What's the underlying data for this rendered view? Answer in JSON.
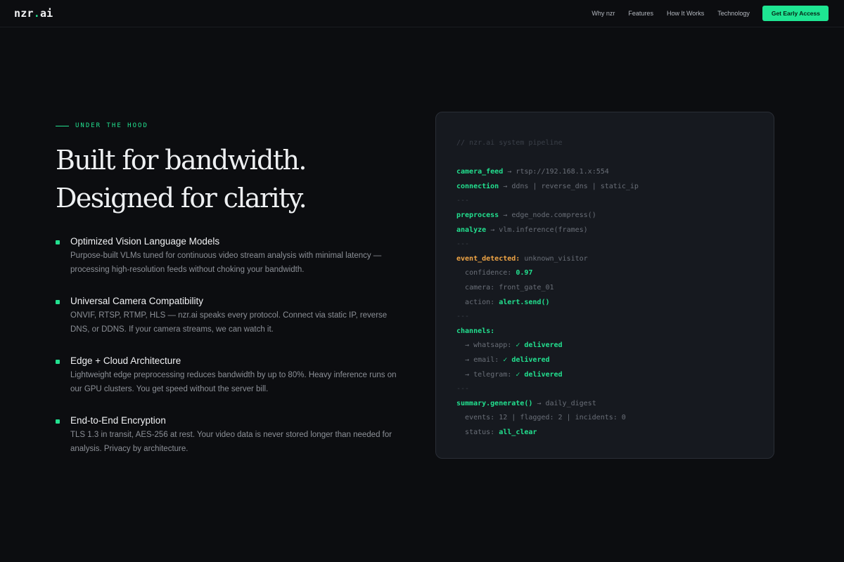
{
  "nav": {
    "logo_main": "nzr",
    "logo_dot": ".",
    "logo_suffix": "ai",
    "links": [
      "Why nzr",
      "Features",
      "How It Works",
      "Technology"
    ],
    "cta": "Get Early Access"
  },
  "hero": {
    "eyebrow": "UNDER THE HOOD",
    "headline": "Built for bandwidth. Designed for clarity."
  },
  "features": [
    {
      "title": "Optimized Vision Language Models",
      "desc": "Purpose-built VLMs tuned for continuous video stream analysis with minimal latency — processing high-resolution feeds without choking your bandwidth."
    },
    {
      "title": "Universal Camera Compatibility",
      "desc": "ONVIF, RTSP, RTMP, HLS — nzr.ai speaks every protocol. Connect via static IP, reverse DNS, or DDNS. If your camera streams, we can watch it."
    },
    {
      "title": "Edge + Cloud Architecture",
      "desc": "Lightweight edge preprocessing reduces bandwidth by up to 80%. Heavy inference runs on our GPU clusters. You get speed without the server bill."
    },
    {
      "title": "End-to-End Encryption",
      "desc": "TLS 1.3 in transit, AES-256 at rest. Your video data is never stored longer than needed for analysis. Privacy by architecture."
    }
  ],
  "code": {
    "comment": "// nzr.ai system pipeline",
    "sep": "---",
    "arrow": "→",
    "check": "✓",
    "camera_feed_key": "camera_feed",
    "camera_feed_val": "rtsp://192.168.1.x:554",
    "connection_key": "connection",
    "connection_val": "ddns | reverse_dns | static_ip",
    "preprocess_key": "preprocess",
    "preprocess_val": "edge_node.compress()",
    "analyze_key": "analyze",
    "analyze_val": "vlm.inference(frames)",
    "event_key": "event_detected:",
    "event_val": "unknown_visitor",
    "confidence_key": "confidence:",
    "confidence_val": "0.97",
    "camera_key": "camera:",
    "camera_val": "front_gate_01",
    "action_key": "action:",
    "action_val": "alert.send()",
    "channels_key": "channels:",
    "channels": [
      {
        "name": "whatsapp:",
        "status": "delivered"
      },
      {
        "name": "email:",
        "status": "delivered"
      },
      {
        "name": "telegram:",
        "status": "delivered"
      }
    ],
    "summary_key": "summary.generate()",
    "summary_val": "daily_digest",
    "events_line": "events: 12 | flagged: 2 | incidents: 0",
    "status_key": "status:",
    "status_val": "all_clear"
  },
  "colors": {
    "accent": "#22e08f",
    "warning": "#f0a545",
    "background": "#0c0d10",
    "card": "#16191f"
  }
}
